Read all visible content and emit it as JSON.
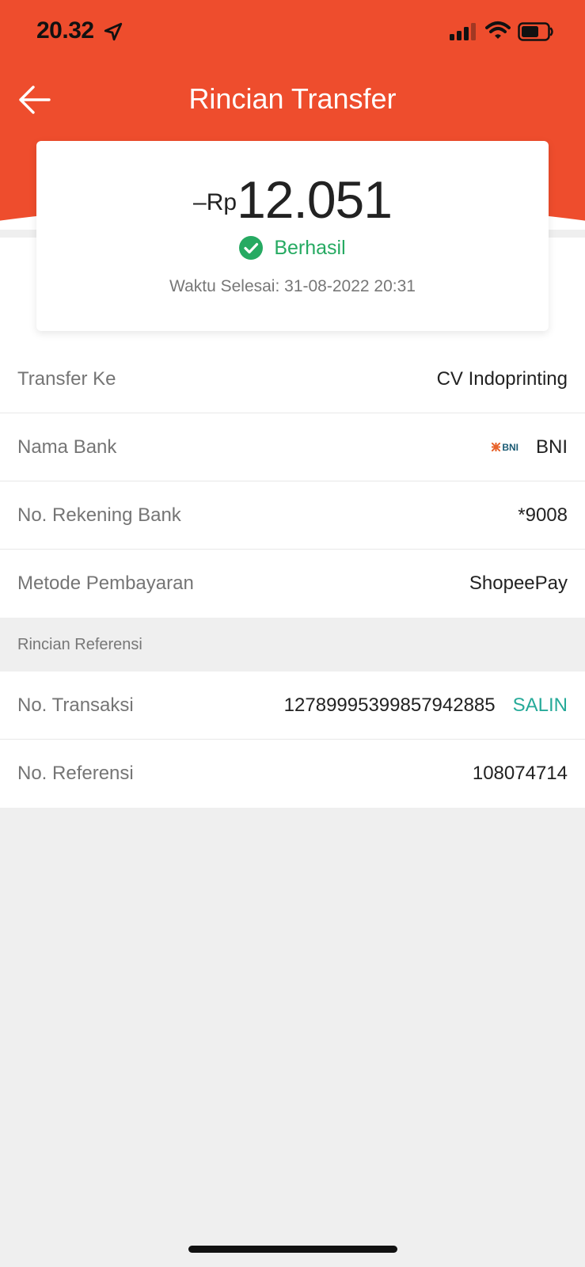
{
  "status_bar": {
    "time": "20.32"
  },
  "header": {
    "title": "Rincian Transfer",
    "accent_color": "#ee4d2d"
  },
  "summary": {
    "amount_prefix": "–Rp",
    "amount_value": "12.051",
    "status": "Berhasil",
    "status_color": "#26aa62",
    "completed_time": "Waktu Selesai: 31-08-2022 20:31"
  },
  "details": {
    "transfer_to": {
      "label": "Transfer Ke",
      "value": "CV Indoprinting"
    },
    "bank_name": {
      "label": "Nama Bank",
      "logo_text": "BNI",
      "value": "BNI"
    },
    "account_number": {
      "label": "No. Rekening Bank",
      "value": "*9008"
    },
    "payment_method": {
      "label": "Metode Pembayaran",
      "value": "ShopeePay"
    }
  },
  "reference": {
    "section_title": "Rincian Referensi",
    "transaction": {
      "label": "No. Transaksi",
      "value": "1278999539985 7942885",
      "copy_label": "SALIN"
    },
    "reference_no": {
      "label": "No. Referensi",
      "value": "108074714"
    }
  }
}
